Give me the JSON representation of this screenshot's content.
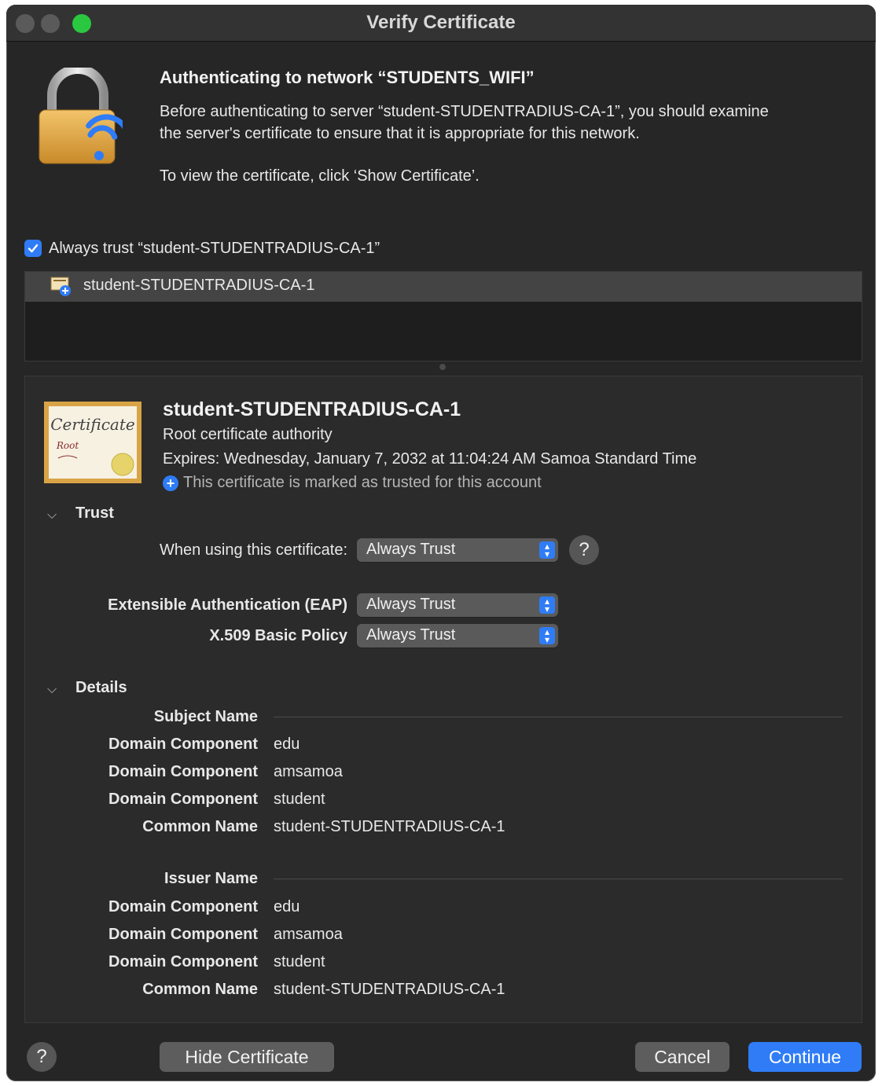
{
  "window": {
    "title": "Verify Certificate",
    "traffic_light_colors": [
      "#5a5a5a",
      "#5a5a5a",
      "#2ac840"
    ]
  },
  "header": {
    "heading": "Authenticating to network “STUDENTS_WIFI”",
    "paragraph_line1": "Before authenticating to server “student-STUDENTRADIUS-CA-1”, you should examine",
    "paragraph_line2": "the server's certificate to ensure that it is appropriate for this network.",
    "instruction": "To view the certificate, click ‘Show Certificate’."
  },
  "always_trust": {
    "checked": true,
    "label": "Always trust “student-STUDENTRADIUS-CA-1”"
  },
  "cert_list": {
    "items": [
      {
        "label": "student-STUDENTRADIUS-CA-1",
        "selected": true
      }
    ]
  },
  "certificate": {
    "icon_text": "Certificate",
    "icon_subtext": "Root",
    "name": "student-STUDENTRADIUS-CA-1",
    "kind": "Root certificate authority",
    "expires": "Expires: Wednesday, January 7, 2032 at 11:04:24 AM Samoa Standard Time",
    "trust_status": "This certificate is marked as trusted for this account"
  },
  "trust": {
    "section_label": "Trust",
    "when_using_label": "When using this certificate:",
    "when_using_value": "Always Trust",
    "eap_label": "Extensible Authentication (EAP)",
    "eap_value": "Always Trust",
    "x509_label": "X.509 Basic Policy",
    "x509_value": "Always Trust"
  },
  "details": {
    "section_label": "Details",
    "subject": {
      "title": "Subject Name",
      "rows": [
        {
          "label": "Domain Component",
          "value": "edu"
        },
        {
          "label": "Domain Component",
          "value": "amsamoa"
        },
        {
          "label": "Domain Component",
          "value": "student"
        },
        {
          "label": "Common Name",
          "value": "student-STUDENTRADIUS-CA-1"
        }
      ]
    },
    "issuer": {
      "title": "Issuer Name",
      "rows": [
        {
          "label": "Domain Component",
          "value": "edu"
        },
        {
          "label": "Domain Component",
          "value": "amsamoa"
        },
        {
          "label": "Domain Component",
          "value": "student"
        },
        {
          "label": "Common Name",
          "value": "student-STUDENTRADIUS-CA-1"
        }
      ]
    }
  },
  "footer": {
    "help_label": "?",
    "hide_certificate_label": "Hide Certificate",
    "cancel_label": "Cancel",
    "continue_label": "Continue",
    "accent_color": "#2f7cf6"
  }
}
